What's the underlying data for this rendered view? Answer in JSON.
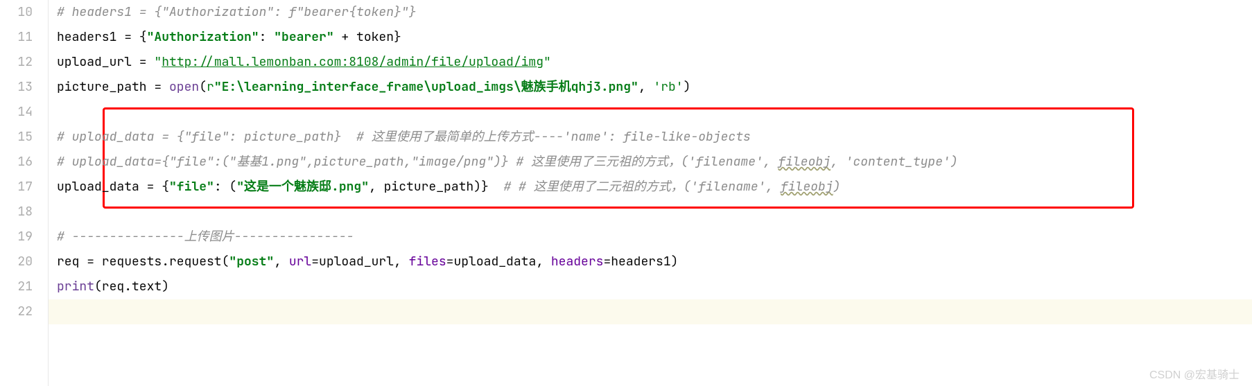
{
  "lines": [
    {
      "num": "10",
      "tokens": [
        {
          "cls": "c-comment",
          "txt": "# headers1 = {\"Authorization\": f\"bearer{token}\"}"
        }
      ]
    },
    {
      "num": "11",
      "tokens": [
        {
          "cls": "c-default",
          "txt": "headers1 = {"
        },
        {
          "cls": "c-strbold",
          "txt": "\"Authorization\""
        },
        {
          "cls": "c-default",
          "txt": ": "
        },
        {
          "cls": "c-strbold",
          "txt": "\"bearer\""
        },
        {
          "cls": "c-default",
          "txt": " + token}"
        }
      ]
    },
    {
      "num": "12",
      "tokens": [
        {
          "cls": "c-default",
          "txt": "upload_url = "
        },
        {
          "cls": "c-string",
          "txt": "\""
        },
        {
          "cls": "c-string c-underline",
          "txt": "http://mall.lemonban.com:8108/admin/file/upload/img"
        },
        {
          "cls": "c-string",
          "txt": "\""
        }
      ]
    },
    {
      "num": "13",
      "tokens": [
        {
          "cls": "c-default",
          "txt": "picture_path = "
        },
        {
          "cls": "c-builtin",
          "txt": "open"
        },
        {
          "cls": "c-default",
          "txt": "("
        },
        {
          "cls": "c-string",
          "txt": "r"
        },
        {
          "cls": "c-strbold",
          "txt": "\"E:\\learning_interface_frame\\upload_imgs\\魅族手机qhj3.png\""
        },
        {
          "cls": "c-default",
          "txt": ", "
        },
        {
          "cls": "c-string",
          "txt": "'rb'"
        },
        {
          "cls": "c-default",
          "txt": ")"
        }
      ]
    },
    {
      "num": "14",
      "tokens": []
    },
    {
      "num": "15",
      "tokens": [
        {
          "cls": "c-comment",
          "txt": "# upload_data = {\"file\": picture_path}  # 这里使用了最简单的上传方式----'name': file-like-objects"
        }
      ]
    },
    {
      "num": "16",
      "tokens": [
        {
          "cls": "c-comment",
          "txt": "# upload_data={\"file\":(\"基基1.png\",picture_path,\"image/png\")} # 这里使用了三元祖的方式，('filename', "
        },
        {
          "cls": "c-comment c-typo",
          "txt": "fileobj"
        },
        {
          "cls": "c-comment",
          "txt": ", 'content_type')"
        }
      ]
    },
    {
      "num": "17",
      "tokens": [
        {
          "cls": "c-default",
          "txt": "upload_data = {"
        },
        {
          "cls": "c-strbold",
          "txt": "\"file\""
        },
        {
          "cls": "c-default",
          "txt": ": ("
        },
        {
          "cls": "c-strbold",
          "txt": "\"这是一个魅族邸.png\""
        },
        {
          "cls": "c-default",
          "txt": ", picture_path)}  "
        },
        {
          "cls": "c-comment",
          "txt": "# # 这里使用了二元祖的方式，('filename', "
        },
        {
          "cls": "c-comment c-typo",
          "txt": "fileobj"
        },
        {
          "cls": "c-comment",
          "txt": ")"
        }
      ]
    },
    {
      "num": "18",
      "tokens": []
    },
    {
      "num": "19",
      "tokens": [
        {
          "cls": "c-comment",
          "txt": "# ---------------上传图片----------------"
        }
      ]
    },
    {
      "num": "20",
      "tokens": [
        {
          "cls": "c-default",
          "txt": "req = requests.request("
        },
        {
          "cls": "c-strbold",
          "txt": "\"post\""
        },
        {
          "cls": "c-default",
          "txt": ", "
        },
        {
          "cls": "c-param",
          "txt": "url"
        },
        {
          "cls": "c-default",
          "txt": "=upload_url, "
        },
        {
          "cls": "c-param",
          "txt": "files"
        },
        {
          "cls": "c-default",
          "txt": "=upload_data, "
        },
        {
          "cls": "c-param",
          "txt": "headers"
        },
        {
          "cls": "c-default",
          "txt": "=headers1)"
        }
      ]
    },
    {
      "num": "21",
      "tokens": [
        {
          "cls": "c-builtin",
          "txt": "print"
        },
        {
          "cls": "c-default",
          "txt": "(req.text)"
        }
      ]
    },
    {
      "num": "22",
      "tokens": [],
      "current": true
    }
  ],
  "watermark": "CSDN @宏基骑士"
}
